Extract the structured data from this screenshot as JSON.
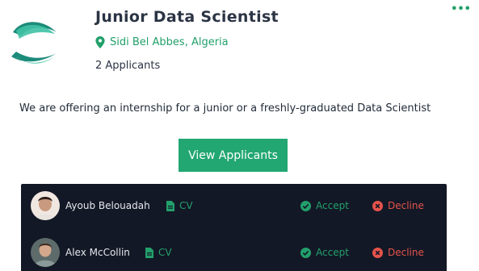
{
  "job": {
    "title": "Junior Data Scientist",
    "location": "Sidi Bel Abbes, Algeria",
    "applicants_count": "2 Applicants",
    "description": "We are offering an internship for a junior or a freshly-graduated Data Scientist",
    "more_icon": "more-dots-icon",
    "logo_icon": "company-logo"
  },
  "actions": {
    "view_applicants_label": "View Applicants"
  },
  "applicants": [
    {
      "name": "Ayoub Belouadah",
      "cv_label": "CV",
      "accept_label": "Accept",
      "decline_label": "Decline"
    },
    {
      "name": "Alex McCollin",
      "cv_label": "CV",
      "accept_label": "Accept",
      "decline_label": "Decline"
    }
  ],
  "colors": {
    "accent": "#22a06b",
    "button": "#22a772",
    "panel": "#131826",
    "decline": "#e5534b"
  }
}
